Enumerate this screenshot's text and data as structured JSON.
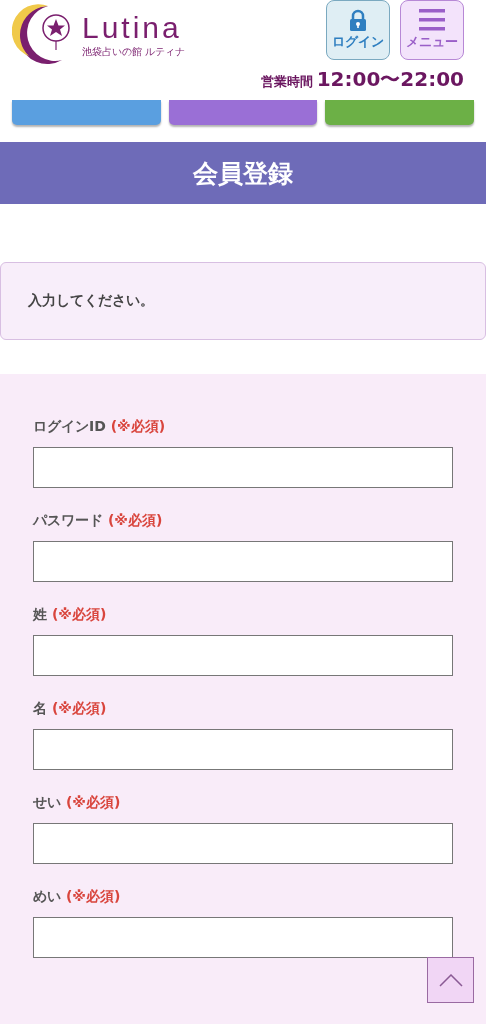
{
  "header": {
    "logo_name": "Lutina",
    "logo_sub": "池袋占いの館 ルティナ",
    "login_button": "ログイン",
    "menu_button": "メニュー",
    "hours_label": "営業時間",
    "hours": "12:00〜22:00"
  },
  "nav_buttons": [
    {
      "color": "#5a9fe0"
    },
    {
      "color": "#9a6fd6"
    },
    {
      "color": "#6cb046"
    }
  ],
  "page_title": "会員登録",
  "notice": "入力してください。",
  "fields": [
    {
      "label": "ログインID",
      "required": "(※必須)"
    },
    {
      "label": "パスワード",
      "required": "(※必須)"
    },
    {
      "label": "姓",
      "required": "(※必須)"
    },
    {
      "label": "名",
      "required": "(※必須)"
    },
    {
      "label": "せい",
      "required": "(※必須)"
    },
    {
      "label": "めい",
      "required": "(※必須)"
    }
  ]
}
